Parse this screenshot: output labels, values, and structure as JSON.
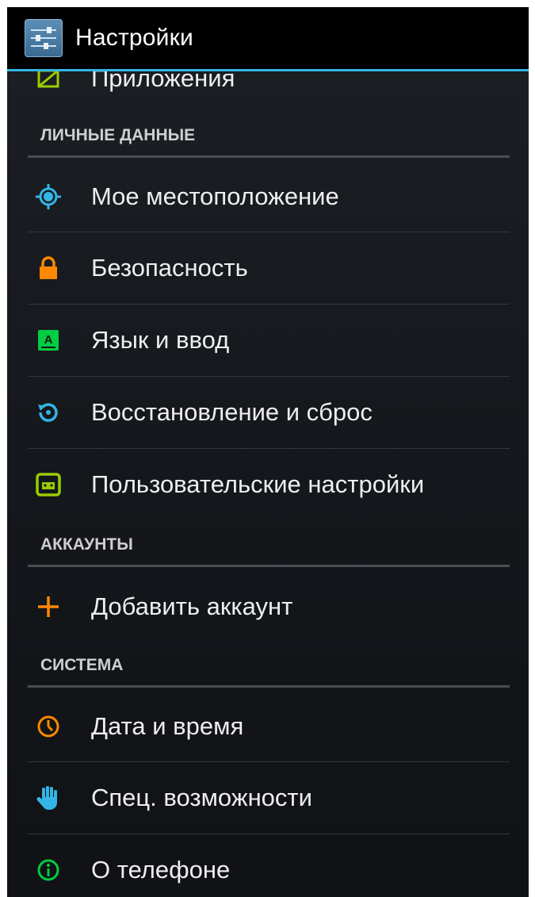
{
  "action_bar": {
    "title": "Настройки",
    "icon": "settings-sliders-icon"
  },
  "colors": {
    "accent": "#33b5e5",
    "background": "#16191d",
    "header_line": "#4a4d52",
    "divider": "#34383d"
  },
  "items": {
    "apps": {
      "label": "Приложения",
      "icon": "apps-icon",
      "icon_color": "#99cc00"
    },
    "location": {
      "label": "Мое местоположение",
      "icon": "location-icon",
      "icon_color": "#33b5e5"
    },
    "security": {
      "label": "Безопасность",
      "icon": "lock-icon",
      "icon_color": "#ff8800"
    },
    "language": {
      "label": "Язык и ввод",
      "icon": "keyboard-language-icon",
      "icon_color": "#00cc44"
    },
    "backup": {
      "label": "Восстановление и сброс",
      "icon": "backup-reset-icon",
      "icon_color": "#33b5e5"
    },
    "custom": {
      "label": "Пользовательские настройки",
      "icon": "android-custom-icon",
      "icon_color": "#99cc00"
    },
    "add_account": {
      "label": "Добавить аккаунт",
      "icon": "plus-icon",
      "icon_color": "#ff8800"
    },
    "datetime": {
      "label": "Дата и время",
      "icon": "clock-icon",
      "icon_color": "#ff8800"
    },
    "accessibility": {
      "label": "Спец. возможности",
      "icon": "hand-icon",
      "icon_color": "#33b5e5"
    },
    "about": {
      "label": "О телефоне",
      "icon": "info-icon",
      "icon_color": "#00cc44"
    }
  },
  "sections": {
    "personal": "ЛИЧНЫЕ ДАННЫЕ",
    "accounts": "АККАУНТЫ",
    "system": "СИСТЕМА"
  }
}
